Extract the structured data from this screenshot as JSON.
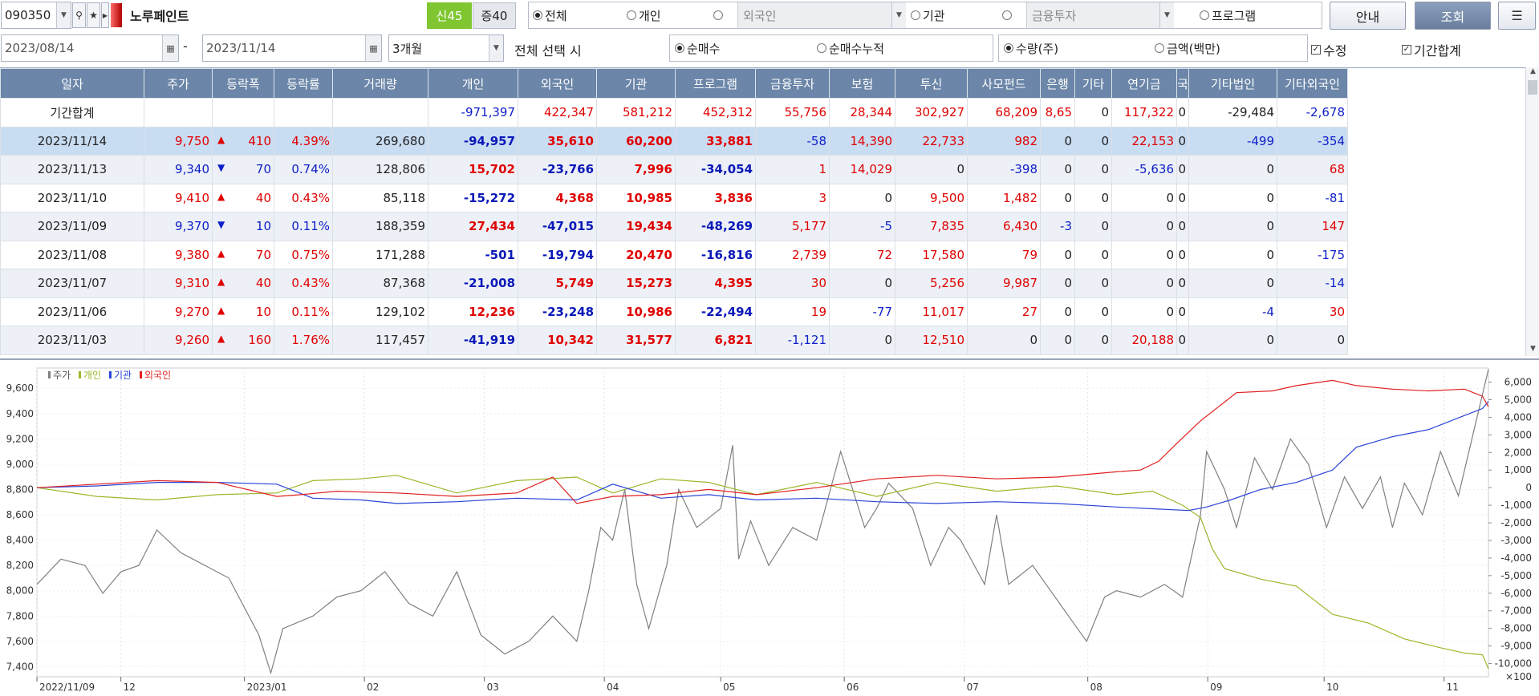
{
  "toolbar": {
    "stock_code": "090350",
    "stock_name": "노루페인트",
    "badge_new": "신45",
    "badge_margin": "증40",
    "radio_all": "전체",
    "radio_individual": "개인",
    "field_foreign": "외국인",
    "radio_institution": "기관",
    "field_finance": "금융투자",
    "radio_program": "프로그램",
    "btn_guide": "안내",
    "btn_query": "조회",
    "btn_menu": "☰"
  },
  "filters": {
    "date_from": "2023/08/14",
    "date_sep": "-",
    "date_to": "2023/11/14",
    "period": "3개월",
    "select_all_label": "전체 선택 시",
    "radio_net": "순매수",
    "radio_net_cum": "순매수누적",
    "radio_qty": "수량(주)",
    "radio_amount": "금액(백만)",
    "chk_adjust": "수정",
    "chk_period_sum": "기간합계"
  },
  "table": {
    "headers": [
      "일자",
      "주가",
      "등락폭",
      "등락률",
      "거래량",
      "개인",
      "외국인",
      "기관",
      "프로그램",
      "금융투자",
      "보험",
      "투신",
      "사모펀드",
      "은행",
      "기타",
      "연기금",
      "국",
      "기타법인",
      "기타외국인"
    ],
    "summary": {
      "label": "기간합계",
      "cells": [
        "",
        "",
        "",
        "",
        "-971,397",
        "422,347",
        "581,212",
        "452,312",
        "55,756",
        "28,344",
        "302,927",
        "68,209",
        "8,65",
        "0",
        "117,322",
        "0",
        "-29,484",
        "-2,678"
      ]
    },
    "rows": [
      {
        "date": "2023/11/14",
        "price": "9,750",
        "dir": "up",
        "chg": "410",
        "rate": "4.39%",
        "vol": "269,680",
        "indiv": "-94,957",
        "foreign": "35,610",
        "inst": "60,200",
        "prog": "33,881",
        "fin": "-58",
        "ins": "14,390",
        "trust": "22,733",
        "pef": "982",
        "bank": "0",
        "etc": "0",
        "pension": "22,153",
        "nat": "0",
        "corp": "-499",
        "etcfor": "-354"
      },
      {
        "date": "2023/11/13",
        "price": "9,340",
        "dir": "dn",
        "chg": "70",
        "rate": "0.74%",
        "vol": "128,806",
        "indiv": "15,702",
        "foreign": "-23,766",
        "inst": "7,996",
        "prog": "-34,054",
        "fin": "1",
        "ins": "14,029",
        "trust": "0",
        "pef": "-398",
        "bank": "0",
        "etc": "0",
        "pension": "-5,636",
        "nat": "0",
        "corp": "0",
        "etcfor": "68"
      },
      {
        "date": "2023/11/10",
        "price": "9,410",
        "dir": "up",
        "chg": "40",
        "rate": "0.43%",
        "vol": "85,118",
        "indiv": "-15,272",
        "foreign": "4,368",
        "inst": "10,985",
        "prog": "3,836",
        "fin": "3",
        "ins": "0",
        "trust": "9,500",
        "pef": "1,482",
        "bank": "0",
        "etc": "0",
        "pension": "0",
        "nat": "0",
        "corp": "0",
        "etcfor": "-81"
      },
      {
        "date": "2023/11/09",
        "price": "9,370",
        "dir": "dn",
        "chg": "10",
        "rate": "0.11%",
        "vol": "188,359",
        "indiv": "27,434",
        "foreign": "-47,015",
        "inst": "19,434",
        "prog": "-48,269",
        "fin": "5,177",
        "ins": "-5",
        "trust": "7,835",
        "pef": "6,430",
        "bank": "-3",
        "etc": "0",
        "pension": "0",
        "nat": "0",
        "corp": "0",
        "etcfor": "147"
      },
      {
        "date": "2023/11/08",
        "price": "9,380",
        "dir": "up",
        "chg": "70",
        "rate": "0.75%",
        "vol": "171,288",
        "indiv": "-501",
        "foreign": "-19,794",
        "inst": "20,470",
        "prog": "-16,816",
        "fin": "2,739",
        "ins": "72",
        "trust": "17,580",
        "pef": "79",
        "bank": "0",
        "etc": "0",
        "pension": "0",
        "nat": "0",
        "corp": "0",
        "etcfor": "-175"
      },
      {
        "date": "2023/11/07",
        "price": "9,310",
        "dir": "up",
        "chg": "40",
        "rate": "0.43%",
        "vol": "87,368",
        "indiv": "-21,008",
        "foreign": "5,749",
        "inst": "15,273",
        "prog": "4,395",
        "fin": "30",
        "ins": "0",
        "trust": "5,256",
        "pef": "9,987",
        "bank": "0",
        "etc": "0",
        "pension": "0",
        "nat": "0",
        "corp": "0",
        "etcfor": "-14"
      },
      {
        "date": "2023/11/06",
        "price": "9,270",
        "dir": "up",
        "chg": "10",
        "rate": "0.11%",
        "vol": "129,102",
        "indiv": "12,236",
        "foreign": "-23,248",
        "inst": "10,986",
        "prog": "-22,494",
        "fin": "19",
        "ins": "-77",
        "trust": "11,017",
        "pef": "27",
        "bank": "0",
        "etc": "0",
        "pension": "0",
        "nat": "0",
        "corp": "-4",
        "etcfor": "30"
      },
      {
        "date": "2023/11/03",
        "price": "9,260",
        "dir": "up",
        "chg": "160",
        "rate": "1.76%",
        "vol": "117,457",
        "indiv": "-41,919",
        "foreign": "10,342",
        "inst": "31,577",
        "prog": "6,821",
        "fin": "-1,121",
        "ins": "0",
        "trust": "12,510",
        "pef": "0",
        "bank": "0",
        "etc": "0",
        "pension": "20,188",
        "nat": "0",
        "corp": "0",
        "etcfor": "0"
      }
    ]
  },
  "colors": {
    "price": "#808080",
    "individual": "#9ab82a",
    "institution": "#2a44d8",
    "foreign": "#e02020",
    "header_bg": "#6b86a8",
    "selected_row": "#c8dcf2"
  },
  "chart_data": {
    "type": "line",
    "legend": [
      "주가",
      "개인",
      "기관",
      "외국인"
    ],
    "x_labels": [
      "2022/11/09",
      "12",
      "2023/01",
      "02",
      "03",
      "04",
      "05",
      "06",
      "07",
      "08",
      "09",
      "10",
      "11"
    ],
    "x_label_months": [
      0,
      0.7,
      1.73,
      2.73,
      3.73,
      4.73,
      5.7,
      6.73,
      7.73,
      8.76,
      9.76,
      10.73,
      11.73
    ],
    "left_axis": {
      "ticks": [
        7400,
        7600,
        7800,
        8000,
        8200,
        8400,
        8600,
        8800,
        9000,
        9200,
        9400,
        9600
      ],
      "range": [
        7320,
        9760
      ]
    },
    "right_axis": {
      "unit": "×100",
      "ticks": [
        -10000,
        -9000,
        -8000,
        -7000,
        -6000,
        -5000,
        -4000,
        -3000,
        -2000,
        -1000,
        0,
        1000,
        2000,
        3000,
        4000,
        5000,
        6000
      ],
      "range": [
        -10750,
        6800
      ]
    },
    "x_range": [
      0,
      12.1
    ],
    "series": [
      {
        "name": "주가",
        "axis": "left",
        "color": "#808080",
        "points": [
          [
            0,
            8050
          ],
          [
            0.2,
            8250
          ],
          [
            0.4,
            8200
          ],
          [
            0.55,
            7980
          ],
          [
            0.7,
            8150
          ],
          [
            0.85,
            8200
          ],
          [
            1.0,
            8480
          ],
          [
            1.2,
            8300
          ],
          [
            1.4,
            8200
          ],
          [
            1.6,
            8100
          ],
          [
            1.85,
            7650
          ],
          [
            1.95,
            7350
          ],
          [
            2.05,
            7700
          ],
          [
            2.3,
            7800
          ],
          [
            2.5,
            7950
          ],
          [
            2.7,
            8000
          ],
          [
            2.9,
            8150
          ],
          [
            3.1,
            7900
          ],
          [
            3.3,
            7800
          ],
          [
            3.5,
            8150
          ],
          [
            3.7,
            7650
          ],
          [
            3.9,
            7500
          ],
          [
            4.1,
            7600
          ],
          [
            4.3,
            7800
          ],
          [
            4.5,
            7600
          ],
          [
            4.6,
            8000
          ],
          [
            4.7,
            8500
          ],
          [
            4.8,
            8400
          ],
          [
            4.9,
            8800
          ],
          [
            5.0,
            8050
          ],
          [
            5.1,
            7700
          ],
          [
            5.25,
            8200
          ],
          [
            5.35,
            8800
          ],
          [
            5.5,
            8500
          ],
          [
            5.7,
            8650
          ],
          [
            5.8,
            9150
          ],
          [
            5.85,
            8250
          ],
          [
            5.95,
            8550
          ],
          [
            6.1,
            8200
          ],
          [
            6.3,
            8500
          ],
          [
            6.5,
            8400
          ],
          [
            6.7,
            9100
          ],
          [
            6.9,
            8500
          ],
          [
            7.0,
            8650
          ],
          [
            7.1,
            8850
          ],
          [
            7.3,
            8650
          ],
          [
            7.45,
            8200
          ],
          [
            7.6,
            8500
          ],
          [
            7.7,
            8400
          ],
          [
            7.9,
            8050
          ],
          [
            8.0,
            8600
          ],
          [
            8.1,
            8050
          ],
          [
            8.3,
            8200
          ],
          [
            8.45,
            8000
          ],
          [
            8.6,
            7800
          ],
          [
            8.75,
            7600
          ],
          [
            8.9,
            7950
          ],
          [
            9.0,
            8000
          ],
          [
            9.2,
            7950
          ],
          [
            9.4,
            8050
          ],
          [
            9.55,
            7950
          ],
          [
            9.7,
            8600
          ],
          [
            9.75,
            9100
          ],
          [
            9.9,
            8800
          ],
          [
            10.0,
            8500
          ],
          [
            10.15,
            9050
          ],
          [
            10.3,
            8800
          ],
          [
            10.45,
            9200
          ],
          [
            10.6,
            9000
          ],
          [
            10.75,
            8500
          ],
          [
            10.9,
            8900
          ],
          [
            11.05,
            8650
          ],
          [
            11.2,
            8900
          ],
          [
            11.3,
            8500
          ],
          [
            11.4,
            8850
          ],
          [
            11.55,
            8600
          ],
          [
            11.7,
            9100
          ],
          [
            11.85,
            8750
          ],
          [
            12.0,
            9350
          ],
          [
            12.1,
            9750
          ]
        ]
      },
      {
        "name": "개인",
        "axis": "right",
        "color": "#9ab82a",
        "points": [
          [
            0,
            0
          ],
          [
            0.5,
            -500
          ],
          [
            1.0,
            -700
          ],
          [
            1.5,
            -400
          ],
          [
            2.0,
            -300
          ],
          [
            2.3,
            400
          ],
          [
            2.7,
            500
          ],
          [
            3.0,
            700
          ],
          [
            3.5,
            -300
          ],
          [
            4.0,
            400
          ],
          [
            4.5,
            600
          ],
          [
            4.8,
            -300
          ],
          [
            5.2,
            500
          ],
          [
            5.6,
            300
          ],
          [
            6.0,
            -400
          ],
          [
            6.5,
            300
          ],
          [
            7.0,
            -500
          ],
          [
            7.5,
            300
          ],
          [
            8.0,
            -200
          ],
          [
            8.5,
            100
          ],
          [
            9.0,
            -400
          ],
          [
            9.3,
            -200
          ],
          [
            9.55,
            -1000
          ],
          [
            9.7,
            -1700
          ],
          [
            9.8,
            -3500
          ],
          [
            9.9,
            -4600
          ],
          [
            10.2,
            -5200
          ],
          [
            10.5,
            -5600
          ],
          [
            10.8,
            -7200
          ],
          [
            11.1,
            -7700
          ],
          [
            11.4,
            -8600
          ],
          [
            11.7,
            -9100
          ],
          [
            11.9,
            -9400
          ],
          [
            12.05,
            -9500
          ],
          [
            12.1,
            -10300
          ]
        ]
      },
      {
        "name": "기관",
        "axis": "right",
        "color": "#2a44d8",
        "points": [
          [
            0,
            0
          ],
          [
            0.5,
            100
          ],
          [
            1.0,
            300
          ],
          [
            1.5,
            300
          ],
          [
            2.0,
            200
          ],
          [
            2.3,
            -600
          ],
          [
            2.7,
            -700
          ],
          [
            3.0,
            -900
          ],
          [
            3.5,
            -800
          ],
          [
            4.0,
            -600
          ],
          [
            4.5,
            -700
          ],
          [
            4.8,
            200
          ],
          [
            5.2,
            -600
          ],
          [
            5.6,
            -400
          ],
          [
            6.0,
            -700
          ],
          [
            6.5,
            -600
          ],
          [
            7.0,
            -800
          ],
          [
            7.5,
            -900
          ],
          [
            8.0,
            -800
          ],
          [
            8.5,
            -900
          ],
          [
            9.0,
            -1100
          ],
          [
            9.3,
            -1200
          ],
          [
            9.6,
            -1300
          ],
          [
            9.75,
            -1100
          ],
          [
            9.95,
            -700
          ],
          [
            10.2,
            -100
          ],
          [
            10.5,
            300
          ],
          [
            10.8,
            1000
          ],
          [
            11.0,
            2300
          ],
          [
            11.3,
            2900
          ],
          [
            11.6,
            3300
          ],
          [
            11.9,
            4100
          ],
          [
            12.05,
            4500
          ],
          [
            12.1,
            4900
          ]
        ]
      },
      {
        "name": "외국인",
        "axis": "right",
        "color": "#e02020",
        "points": [
          [
            0,
            0
          ],
          [
            0.5,
            200
          ],
          [
            1.0,
            400
          ],
          [
            1.5,
            300
          ],
          [
            2.0,
            -500
          ],
          [
            2.2,
            -400
          ],
          [
            2.5,
            -200
          ],
          [
            3.0,
            -300
          ],
          [
            3.5,
            -500
          ],
          [
            4.0,
            -300
          ],
          [
            4.3,
            600
          ],
          [
            4.5,
            -900
          ],
          [
            4.8,
            -500
          ],
          [
            5.2,
            -400
          ],
          [
            5.6,
            -100
          ],
          [
            6.0,
            -400
          ],
          [
            6.5,
            0
          ],
          [
            7.0,
            500
          ],
          [
            7.5,
            700
          ],
          [
            8.0,
            500
          ],
          [
            8.5,
            600
          ],
          [
            9.0,
            900
          ],
          [
            9.2,
            1000
          ],
          [
            9.35,
            1500
          ],
          [
            9.5,
            2500
          ],
          [
            9.7,
            3800
          ],
          [
            9.85,
            4600
          ],
          [
            10.0,
            5400
          ],
          [
            10.3,
            5500
          ],
          [
            10.5,
            5800
          ],
          [
            10.8,
            6100
          ],
          [
            11.0,
            5800
          ],
          [
            11.3,
            5600
          ],
          [
            11.6,
            5500
          ],
          [
            11.9,
            5600
          ],
          [
            12.05,
            5200
          ],
          [
            12.1,
            4600
          ]
        ]
      }
    ]
  }
}
